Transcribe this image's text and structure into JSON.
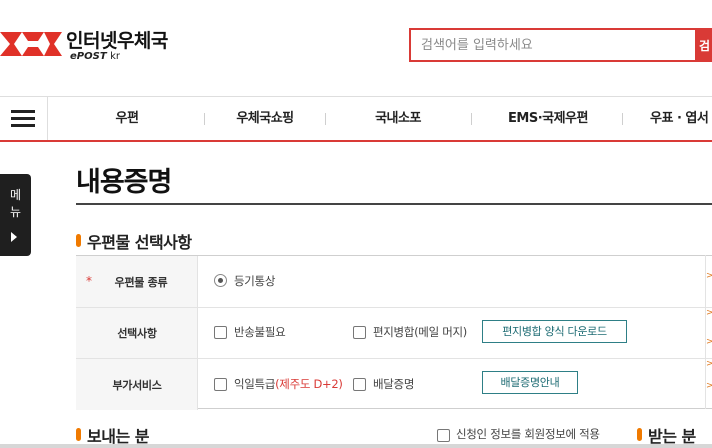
{
  "header": {
    "logo_title": "인터넷우체국",
    "logo_sub_brand": "ePOST",
    "logo_sub_domain": "kr",
    "search_placeholder": "검색어를 입력하세요",
    "search_button": "검"
  },
  "gnb": {
    "items": [
      "우편",
      "우체국쇼핑",
      "국내소포",
      "EMS·국제우편",
      "우표 · 엽서"
    ]
  },
  "side_tab": {
    "chars": [
      "메",
      "뉴"
    ]
  },
  "page": {
    "title": "내용증명",
    "section1_title": "우편물 선택사항",
    "section2_title": "보내는 분",
    "section3_title": "받는 분"
  },
  "form": {
    "row1": {
      "label": "우편물 종류",
      "required_mark": "*",
      "radio_label": "등기통상"
    },
    "row2": {
      "label": "선택사항",
      "opt1": "반송불필요",
      "opt2": "편지병합(메일 머지)",
      "button": "편지병합 양식 다운로드"
    },
    "row3": {
      "label": "부가서비스",
      "opt1_prefix": "익일특급",
      "opt1_note": "(제주도 D+2)",
      "opt2": "배달증명",
      "button": "배달증명안내"
    }
  },
  "sender": {
    "same_as_member_label": "신청인 정보를 회원정보에 적용"
  },
  "side_marks": [
    ">",
    ">",
    ">",
    ">",
    ">"
  ],
  "colors": {
    "accent": "#d93a36",
    "bullet": "#f07a00",
    "teal": "#2e7f86"
  }
}
